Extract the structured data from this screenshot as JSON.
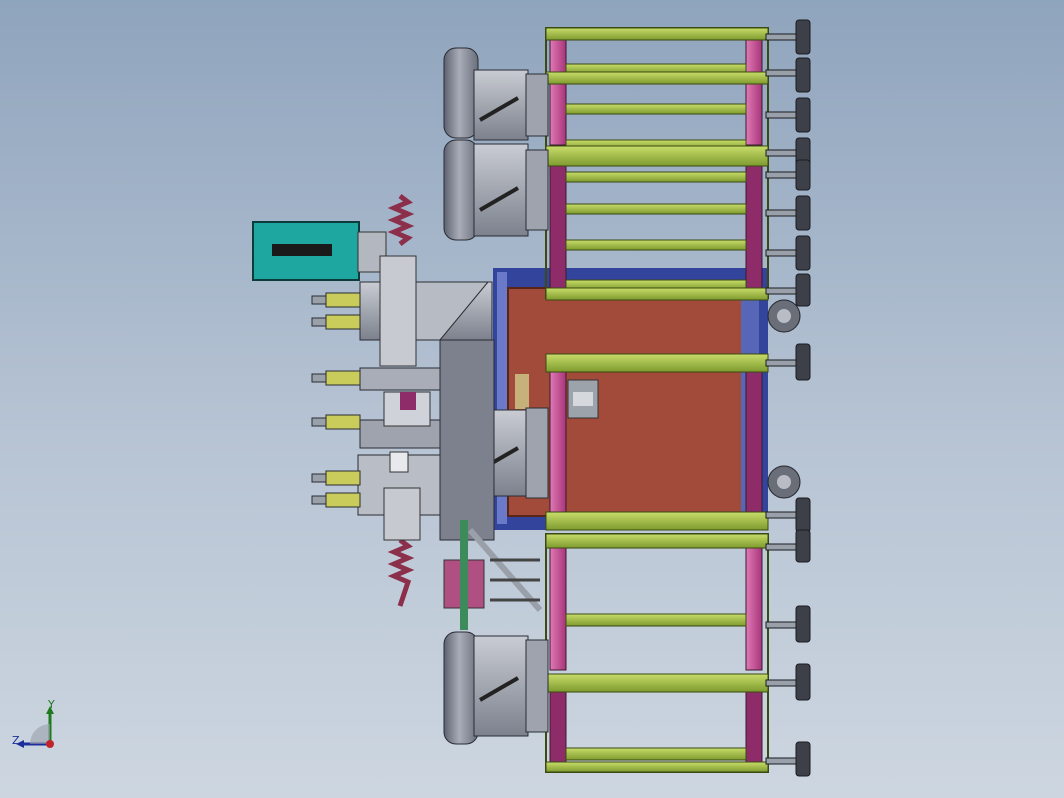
{
  "view": {
    "background_top": "#8fa4bd",
    "background_bottom": "#cdd6e0",
    "content": "cad-3d-assembly"
  },
  "colors": {
    "frame_green": "#a7c34a",
    "frame_green_dark": "#6f8a25",
    "post_magenta": "#d0459a",
    "post_magenta_dark": "#8e2c6a",
    "panel_brown": "#a24b3a",
    "panel_blue": "#3a4fb0",
    "reel_gray": "#8a8f9c",
    "reel_dark": "#4d5260",
    "box_teal": "#1ea6a0",
    "foot_dark": "#3d4049",
    "spring_red": "#8b2f4a"
  },
  "triad": {
    "y_label": "Y",
    "z_label": "Z",
    "icon": "coordinate-triad-icon"
  }
}
